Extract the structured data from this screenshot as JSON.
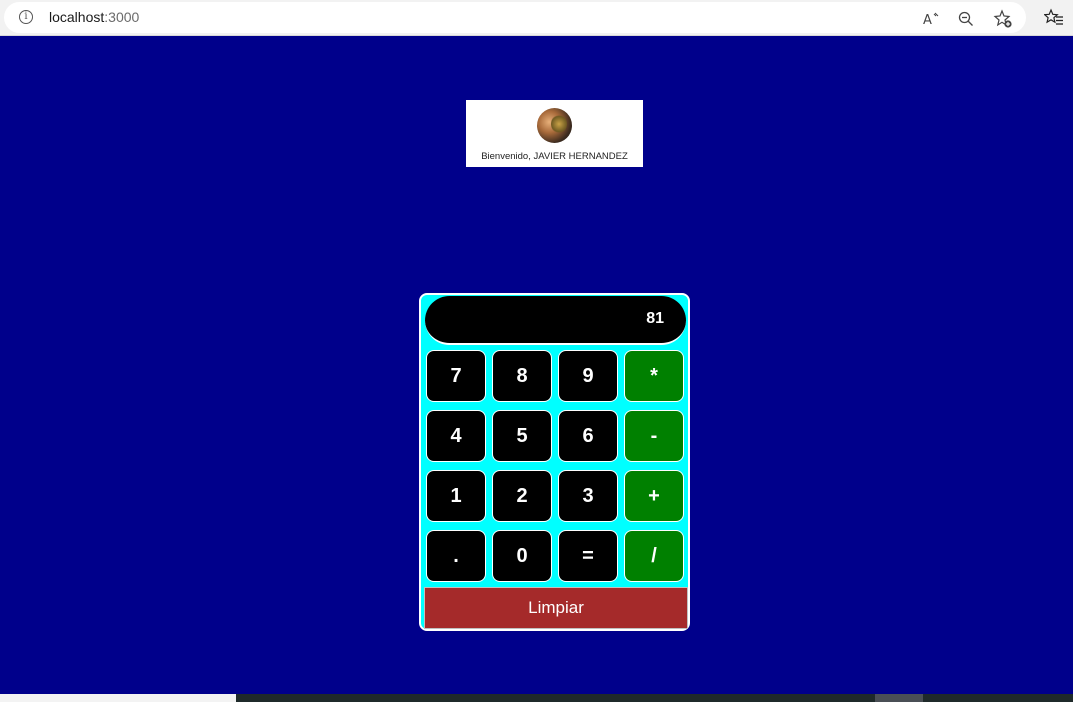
{
  "browser": {
    "url_host": "localhost",
    "url_port": ":3000",
    "icons": [
      "info-icon",
      "read-aloud-icon",
      "zoom-out-icon",
      "add-favorite-icon",
      "favorites-icon"
    ]
  },
  "profile": {
    "welcome_text": "Bienvenido, JAVIER HERNANDEZ",
    "avatar": "user-avatar"
  },
  "calculator": {
    "display_value": "81",
    "rows": [
      [
        "7",
        "8",
        "9",
        "*"
      ],
      [
        "4",
        "5",
        "6",
        "-"
      ],
      [
        "1",
        "2",
        "3",
        "+"
      ],
      [
        ".",
        "0",
        "=",
        "/"
      ]
    ],
    "clear_label": "Limpiar"
  },
  "colors": {
    "page_background": "#00008b",
    "calculator_background": "#00ffff",
    "number_key": "#000000",
    "operator_key": "#008000",
    "clear_button": "#a52a2a"
  }
}
